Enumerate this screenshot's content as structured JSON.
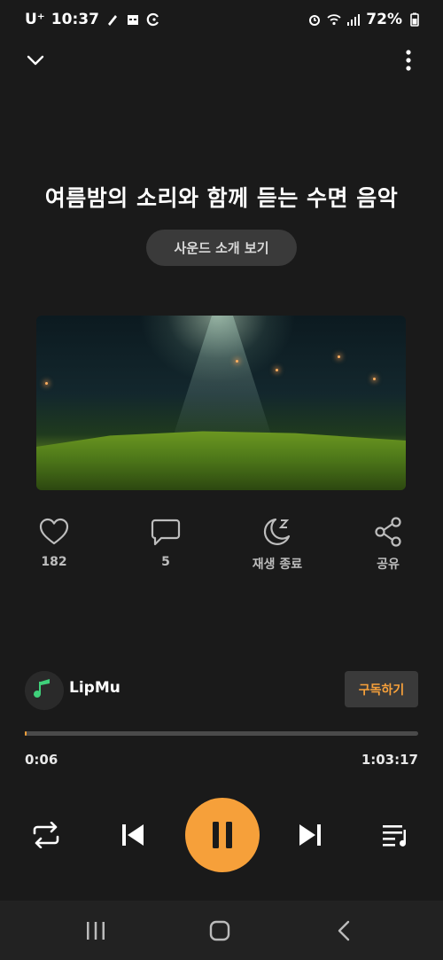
{
  "status_bar": {
    "carrier": "U⁺",
    "time": "10:37",
    "battery": "72%"
  },
  "track": {
    "title": "여름밤의 소리와 함께 듣는 수면 음악",
    "intro_button_label": "사운드 소개 보기"
  },
  "actions": {
    "like_count": "182",
    "comment_count": "5",
    "sleep_label": "재생 종료",
    "share_label": "공유"
  },
  "channel": {
    "name": "LipMu",
    "subscribe_label": "구독하기"
  },
  "playback": {
    "elapsed": "0:06",
    "duration": "1:03:17",
    "progress_fraction": 0.002
  },
  "icons": [
    "chevron-down-icon",
    "more-vertical-icon",
    "heart-icon",
    "comment-icon",
    "moon-sleep-icon",
    "share-icon",
    "repeat-icon",
    "previous-icon",
    "pause-icon",
    "next-icon",
    "playlist-icon",
    "recent-apps-icon",
    "home-icon",
    "back-icon"
  ],
  "colors": {
    "accent": "#f6a03a",
    "background": "#1a1a1a"
  }
}
